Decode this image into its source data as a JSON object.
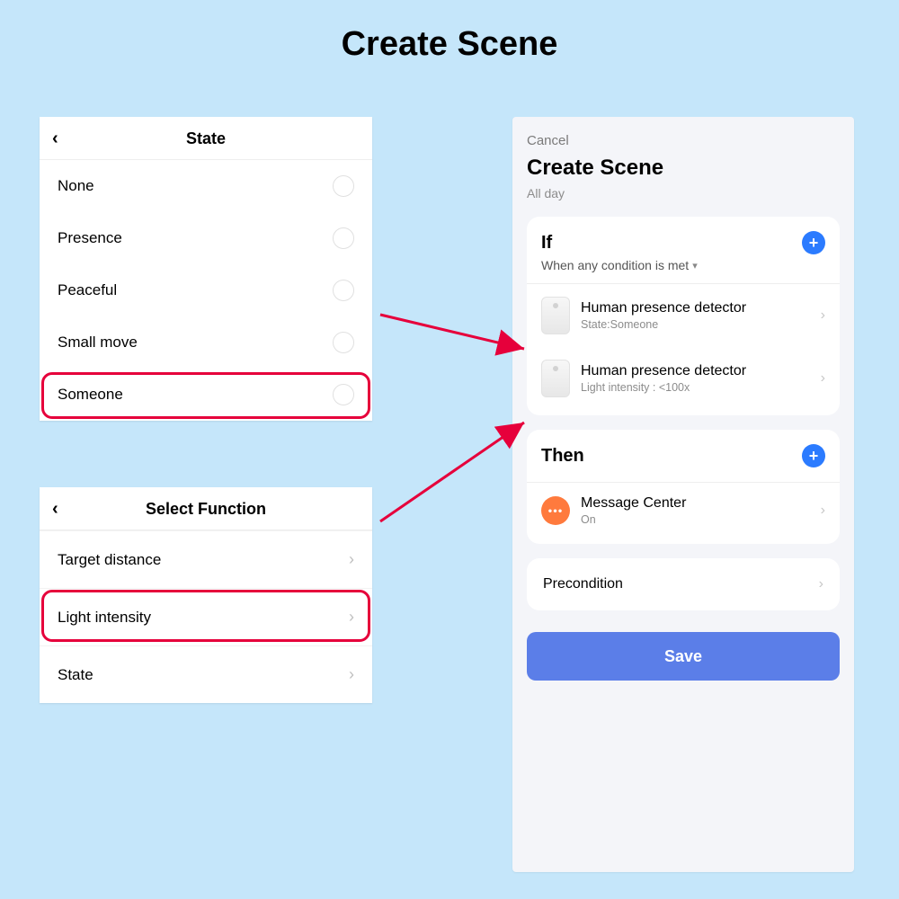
{
  "page_title": "Create Scene",
  "state_panel": {
    "title": "State",
    "options": [
      "None",
      "Presence",
      "Peaceful",
      "Small move",
      "Someone"
    ],
    "highlighted_index": 4
  },
  "func_panel": {
    "title": "Select Function",
    "items": [
      "Target distance",
      "Light intensity",
      "State"
    ],
    "highlighted_index": 1
  },
  "scene_panel": {
    "cancel": "Cancel",
    "title": "Create Scene",
    "subtitle": "All day",
    "if": {
      "heading": "If",
      "condition_label": "When any condition is met",
      "items": [
        {
          "title": "Human presence detector",
          "sub": "State:Someone"
        },
        {
          "title": "Human presence detector",
          "sub": "Light intensity : <100x"
        }
      ]
    },
    "then": {
      "heading": "Then",
      "items": [
        {
          "title": "Message Center",
          "sub": "On",
          "icon": "message"
        }
      ]
    },
    "precondition": "Precondition",
    "save": "Save"
  }
}
